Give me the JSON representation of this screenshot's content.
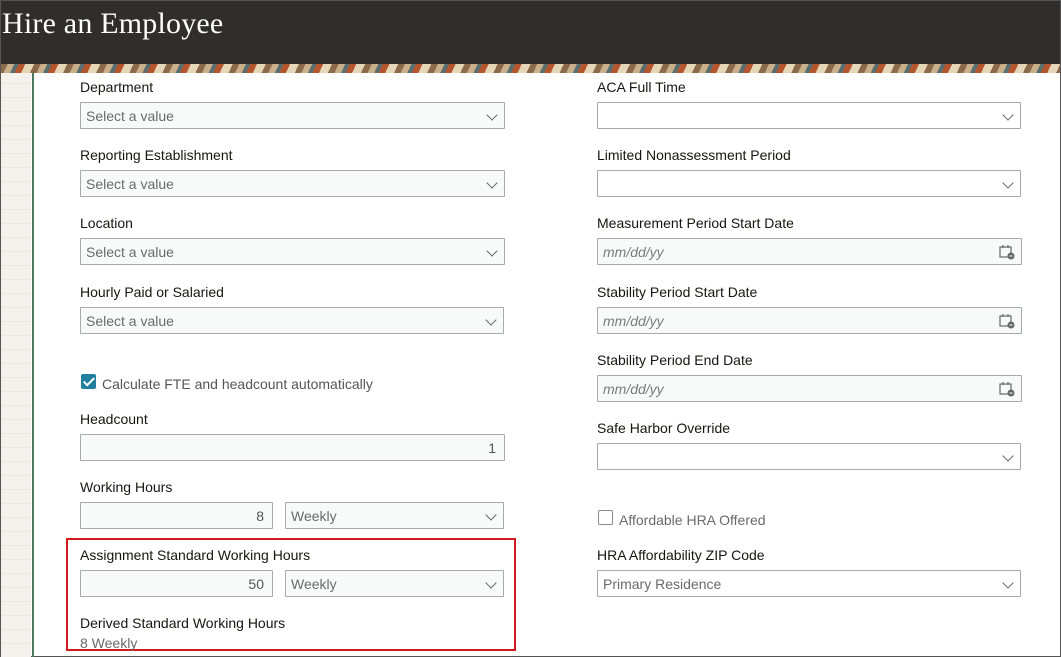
{
  "header": {
    "title": "Hire an Employee"
  },
  "left": {
    "department": {
      "label": "Department",
      "placeholder": "Select a value"
    },
    "reporting_establishment": {
      "label": "Reporting Establishment",
      "placeholder": "Select a value"
    },
    "location": {
      "label": "Location",
      "placeholder": "Select a value"
    },
    "hourly_paid": {
      "label": "Hourly Paid or Salaried",
      "placeholder": "Select a value"
    },
    "calc_fte": {
      "label": "Calculate FTE and headcount automatically",
      "checked": true
    },
    "headcount": {
      "label": "Headcount",
      "value": "1"
    },
    "working_hours": {
      "label": "Working Hours",
      "value": "8",
      "frequency": "Weekly"
    },
    "assignment_hours": {
      "label": "Assignment Standard Working Hours",
      "value": "50",
      "frequency": "Weekly"
    },
    "derived_hours": {
      "label": "Derived Standard Working Hours",
      "value": "8 Weekly"
    }
  },
  "right": {
    "aca_full_time": {
      "label": "ACA Full Time",
      "value": ""
    },
    "limited_nonassessment": {
      "label": "Limited Nonassessment Period",
      "value": ""
    },
    "measurement_start": {
      "label": "Measurement Period Start Date",
      "placeholder": "mm/dd/yy"
    },
    "stability_start": {
      "label": "Stability Period Start Date",
      "placeholder": "mm/dd/yy"
    },
    "stability_end": {
      "label": "Stability Period End Date",
      "placeholder": "mm/dd/yy"
    },
    "safe_harbor": {
      "label": "Safe Harbor Override",
      "value": ""
    },
    "affordable_hra": {
      "label": "Affordable HRA Offered",
      "checked": false
    },
    "hra_zip": {
      "label": "HRA Affordability ZIP Code",
      "value": "Primary Residence"
    }
  },
  "icons": {
    "dropdown": "chevron-down-icon",
    "calendar": "calendar-icon",
    "check": "checkmark-icon"
  },
  "colors": {
    "header_bg": "#312d2a",
    "accent": "#227e9e",
    "highlight_border": "#d11a1a"
  }
}
